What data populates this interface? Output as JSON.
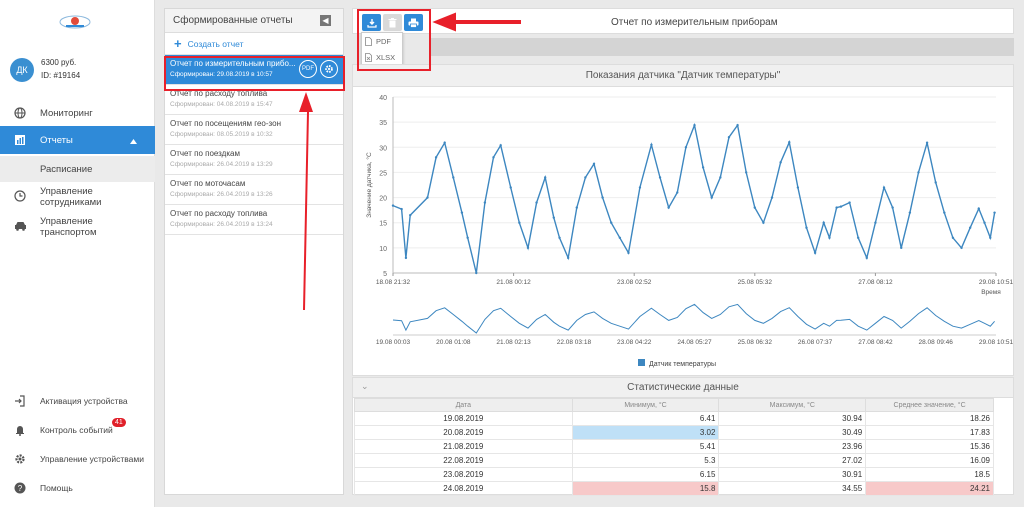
{
  "account": {
    "initials": "ДК",
    "balance": "6300 руб.",
    "id": "ID: #19164"
  },
  "nav": {
    "monitoring": "Мониторинг",
    "reports": "Отчеты",
    "schedule": "Расписание",
    "staff_1": "Управление",
    "staff_2": "сотрудниками",
    "transport_1": "Управление",
    "transport_2": "транспортом",
    "activation": "Активация устройства",
    "events": "Контроль событий",
    "events_badge": "41",
    "devices": "Управление устройствами",
    "help": "Помощь"
  },
  "reports_panel": {
    "title": "Сформированные отчеты",
    "create_label": "Создать отчет",
    "pdf_label": "PDF",
    "items": [
      {
        "title": "Отчет по измерительным прибо...",
        "subtitle": "Сформирован: 29.08.2019 в 10:57"
      },
      {
        "title": "Отчет по расходу топлива",
        "subtitle": "Сформирован: 04.08.2019 в 15:47"
      },
      {
        "title": "Отчет по посещениям гео-зон",
        "subtitle": "Сформирован: 08.05.2019 в 10:32"
      },
      {
        "title": "Отчет по поездкам",
        "subtitle": "Сформирован: 26.04.2019 в 13:29"
      },
      {
        "title": "Отчет по моточасам",
        "subtitle": "Сформирован: 26.04.2019 в 13:26"
      },
      {
        "title": "Отчет по расходу топлива",
        "subtitle": "Сформирован: 26.04.2019 в 13:24"
      }
    ]
  },
  "toolbar": {
    "report_title": "Отчет по измерительным приборам",
    "export_pdf": "PDF",
    "export_xlsx": "XLSX"
  },
  "colors": {
    "accent": "#2f8ad8",
    "line": "#3d87c0",
    "annotation": "#e8202a",
    "badge": "#e0202a"
  },
  "chart_data": {
    "type": "line",
    "title": "Показания датчика \"Датчик температуры\"",
    "ylabel": "Значение датчика, °C",
    "xlabel": "Время",
    "ylim": [
      5,
      40
    ],
    "yticks": [
      5,
      10,
      15,
      20,
      25,
      30,
      35,
      40
    ],
    "xticks": [
      "18.08 21:32",
      "21.08 00:12",
      "23.08 02:52",
      "25.08 05:32",
      "27.08 08:12",
      "29.08 10:51"
    ],
    "navigator_ticks": [
      "19.08 00:03",
      "20.08 01:08",
      "21.08 02:13",
      "22.08 03:18",
      "23.08 04:22",
      "24.08 05:27",
      "25.08 06:32",
      "26.08 07:37",
      "27.08 08:42",
      "28.08 09:46",
      "29.08 10:51"
    ],
    "legend": "Датчик температуры",
    "series": [
      {
        "name": "Датчик температуры",
        "x": [
          0,
          0.3,
          0.45,
          0.6,
          1.2,
          1.5,
          1.8,
          2.1,
          2.4,
          2.6,
          2.9,
          3.2,
          3.5,
          3.75,
          4.1,
          4.4,
          4.7,
          5.0,
          5.3,
          5.6,
          5.8,
          6.1,
          6.4,
          6.7,
          7.0,
          7.3,
          7.6,
          7.9,
          8.2,
          8.6,
          9.0,
          9.3,
          9.6,
          9.9,
          10.2,
          10.5,
          10.8,
          11.1,
          11.4,
          11.7,
          12.0,
          12.3,
          12.6,
          12.9,
          13.2,
          13.5,
          13.8,
          14.1,
          14.4,
          14.7,
          15.0,
          15.2,
          15.45,
          15.6,
          15.9,
          16.2,
          16.5,
          16.8,
          17.1,
          17.4,
          17.7,
          18.0,
          18.3,
          18.6,
          18.9,
          19.2,
          19.5,
          19.8,
          20.1,
          20.4,
          20.6,
          20.8,
          20.95
        ],
        "values": [
          18.4,
          17.7,
          8,
          16.5,
          20,
          28,
          30.9,
          24,
          17,
          12,
          5,
          19,
          28,
          30.4,
          22,
          15,
          10,
          19,
          24,
          16,
          12,
          8,
          18,
          24,
          26.7,
          20,
          15,
          12,
          9,
          22,
          30.5,
          24,
          18,
          21,
          30,
          34.4,
          26,
          20,
          24,
          32,
          34.4,
          25,
          18,
          15,
          20,
          27,
          31,
          22,
          14,
          9,
          15,
          12,
          18,
          18.2,
          19,
          12,
          8,
          15,
          22,
          18,
          10,
          17,
          25,
          30.9,
          23,
          17,
          12,
          10,
          14,
          17.8,
          15,
          12,
          17
        ]
      }
    ]
  },
  "stats": {
    "title": "Статистические данные",
    "headers": [
      "Дата",
      "Минимум, °C",
      "Максимум, °C",
      "Среднее значение, °C"
    ],
    "rows": [
      [
        "19.08.2019",
        "6.41",
        "30.94",
        "18.26"
      ],
      [
        "20.08.2019",
        "3.02",
        "30.49",
        "17.83"
      ],
      [
        "21.08.2019",
        "5.41",
        "23.96",
        "15.36"
      ],
      [
        "22.08.2019",
        "5.3",
        "27.02",
        "16.09"
      ],
      [
        "23.08.2019",
        "6.15",
        "30.91",
        "18.5"
      ],
      [
        "24.08.2019",
        "15.8",
        "34.55",
        "24.21"
      ]
    ]
  }
}
